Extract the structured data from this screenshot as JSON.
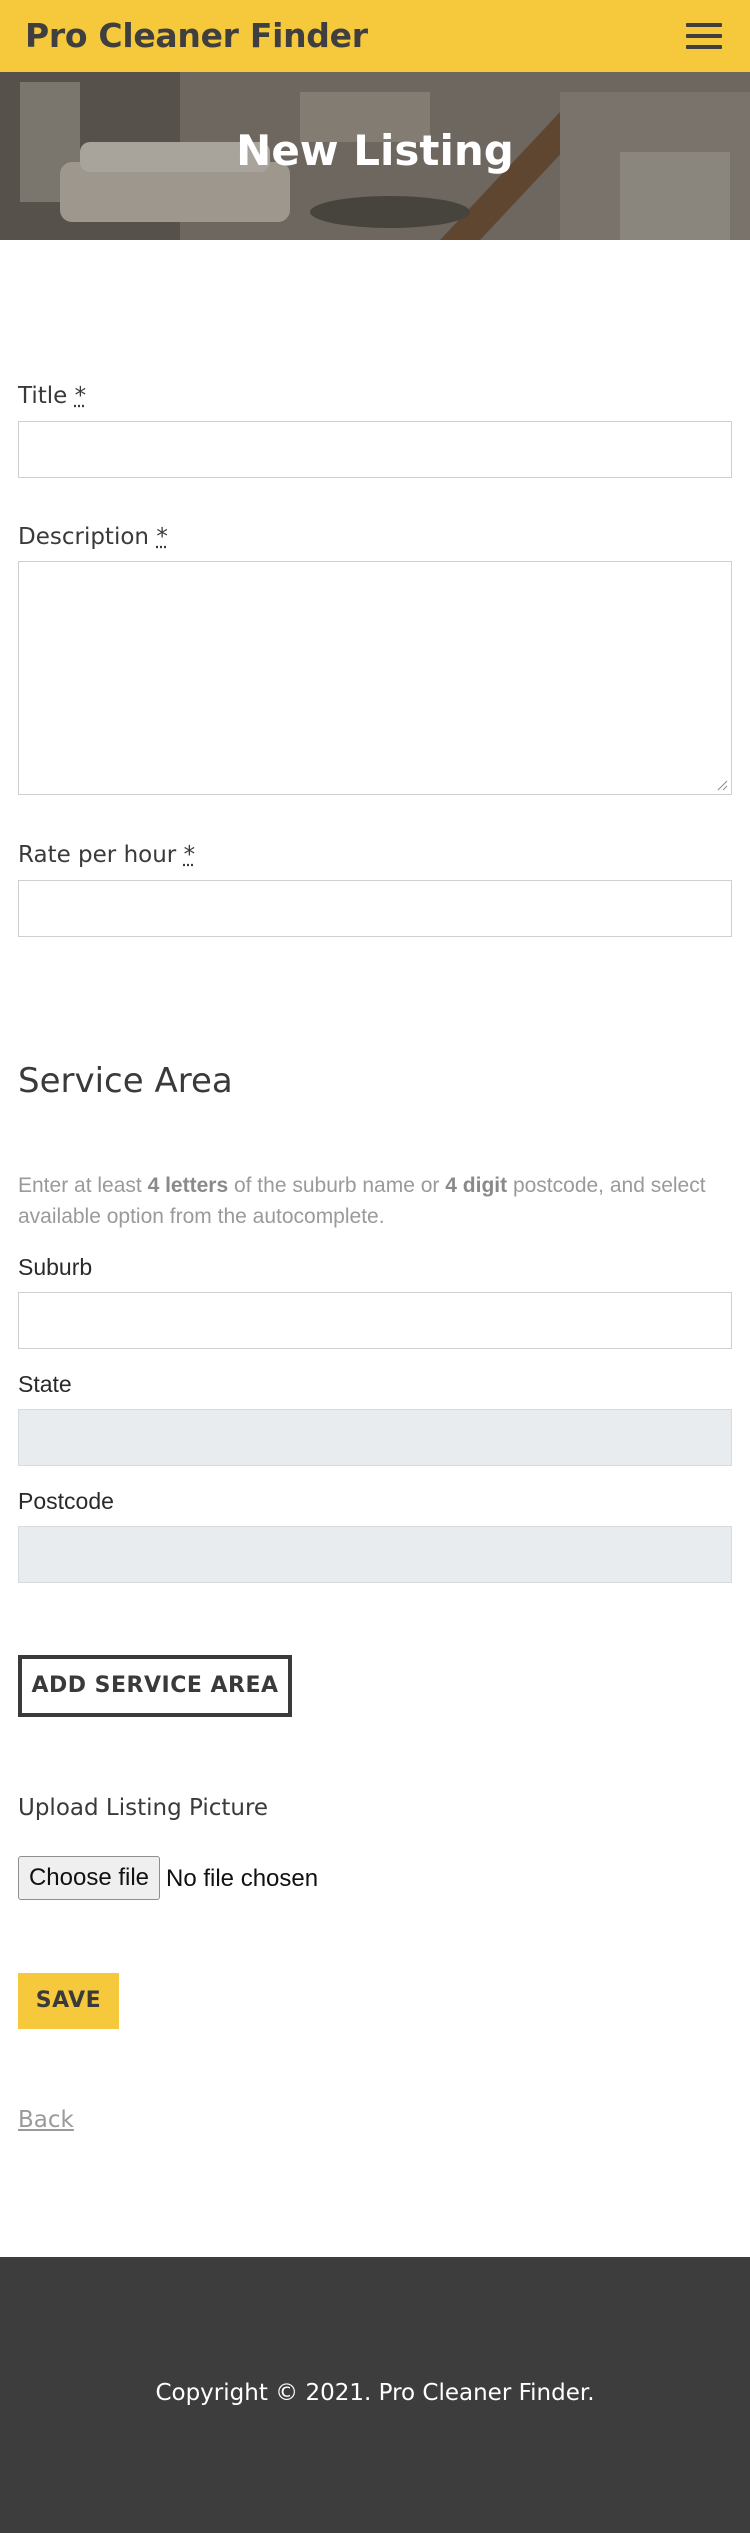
{
  "navbar": {
    "brand": "Pro Cleaner Finder",
    "menu_icon": "hamburger-menu-icon",
    "background_color": "#f5c93b"
  },
  "hero": {
    "title": "New Listing"
  },
  "form": {
    "title": {
      "label": "Title",
      "required_mark": "*",
      "value": ""
    },
    "description": {
      "label": "Description",
      "required_mark": "*",
      "value": ""
    },
    "rate": {
      "label": "Rate per hour",
      "required_mark": "*",
      "value": ""
    }
  },
  "service_area": {
    "heading": "Service Area",
    "help": {
      "part1": "Enter at least ",
      "bold1": "4 letters",
      "part2": " of the suburb name or ",
      "bold2": "4 digit",
      "part3": " postcode, and select available option from the autocomplete."
    },
    "suburb": {
      "label": "Suburb",
      "value": ""
    },
    "state": {
      "label": "State",
      "value": ""
    },
    "postcode": {
      "label": "Postcode",
      "value": ""
    },
    "add_button": "ADD SERVICE AREA"
  },
  "upload": {
    "label": "Upload Listing Picture",
    "button": "Choose file",
    "status": "No file chosen"
  },
  "actions": {
    "save": "SAVE",
    "back": "Back"
  },
  "footer": {
    "copyright": "Copyright © 2021. Pro Cleaner Finder.",
    "background_color": "#3d3d3d"
  }
}
